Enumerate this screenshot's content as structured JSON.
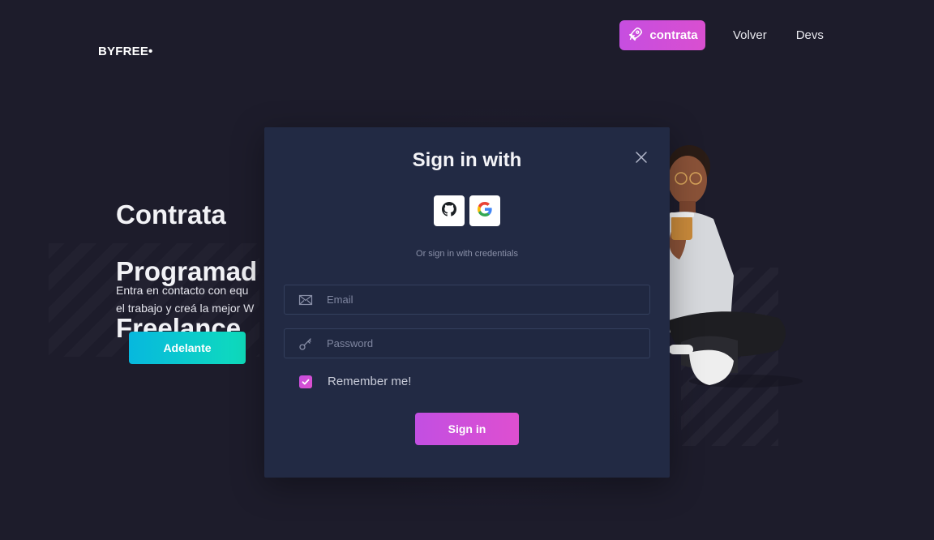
{
  "brand": {
    "logo": "BYFREE•"
  },
  "nav": {
    "cta_label": "contrata",
    "links": [
      "Volver",
      "Devs"
    ]
  },
  "hero": {
    "title_lines": [
      "Contrata",
      "Programad",
      "Freelance"
    ],
    "text_lines": [
      "Entra en contacto con equ",
      "el trabajo y creá la mejor W"
    ],
    "button_label": "Adelante"
  },
  "modal": {
    "title": "Sign in with",
    "divider_text": "Or sign in with credentials",
    "email_placeholder": "Email",
    "password_placeholder": "Password",
    "remember_label": "Remember me!",
    "remember_checked": true,
    "submit_label": "Sign in",
    "social": [
      "github-icon",
      "google-icon"
    ]
  },
  "colors": {
    "background": "#1d1c2b",
    "modal": "#222a44",
    "accent": "#d94fd0",
    "teal": "#0fdcbc"
  }
}
